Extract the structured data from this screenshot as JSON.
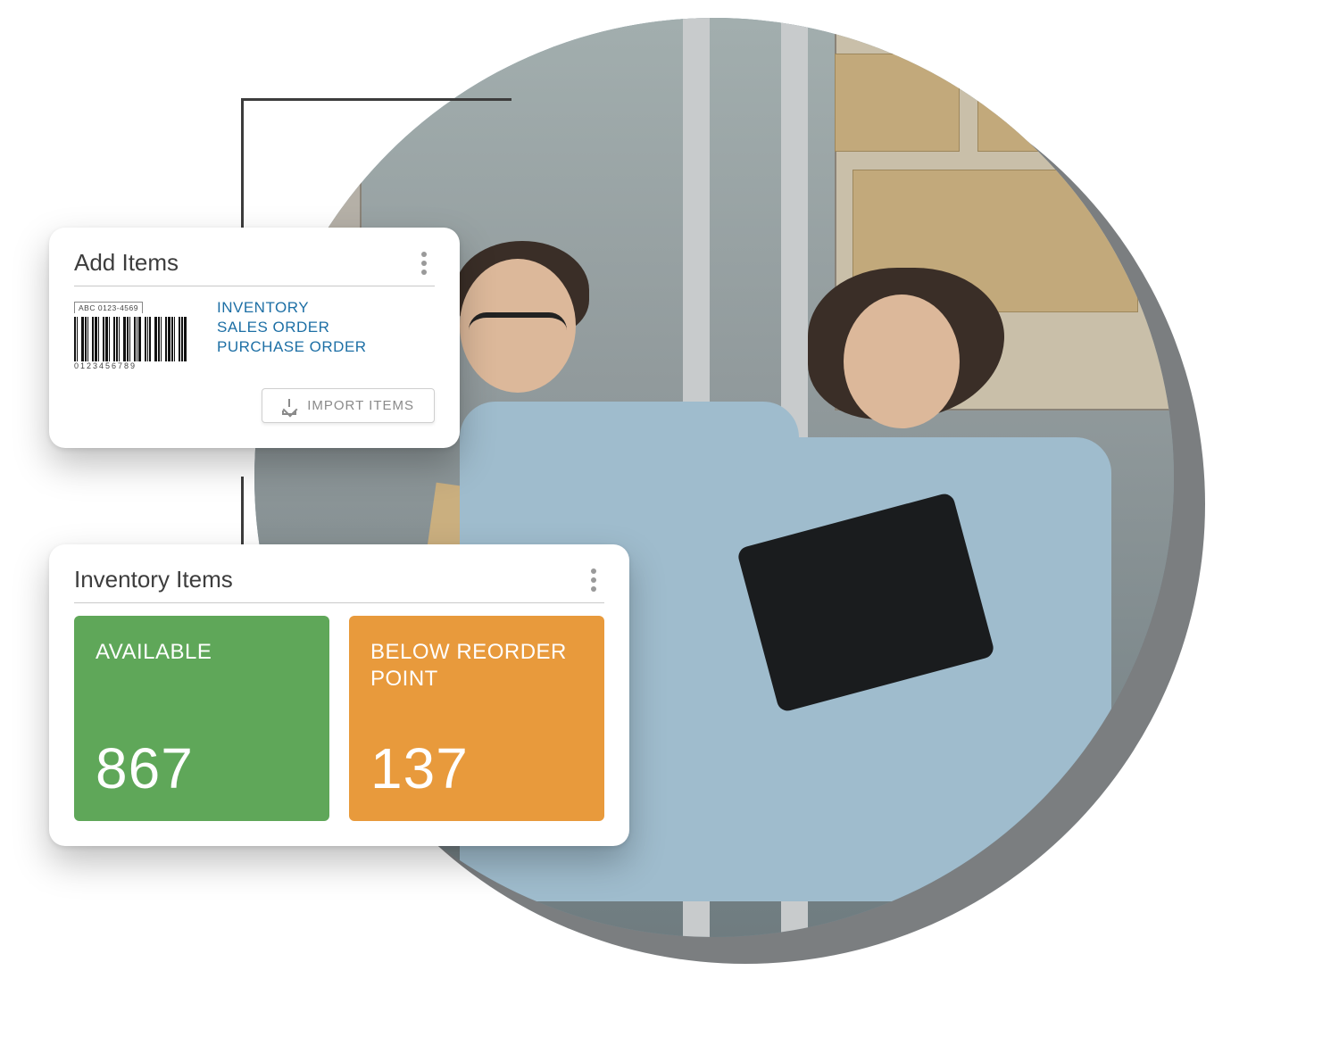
{
  "addItems": {
    "title": "Add Items",
    "barcode": {
      "topLabel": "ABC 0123-4569",
      "bottomLabel": "0123456789"
    },
    "links": [
      "INVENTORY",
      "SALES ORDER",
      "PURCHASE ORDER"
    ],
    "importButton": "IMPORT ITEMS"
  },
  "inventoryItems": {
    "title": "Inventory Items",
    "tiles": [
      {
        "label": "AVAILABLE",
        "value": "867",
        "color": "green"
      },
      {
        "label": "BELOW REORDER POINT",
        "value": "137",
        "color": "orange"
      }
    ]
  },
  "colors": {
    "green": "#5fa759",
    "orange": "#e89a3c",
    "link": "#1d6fa5"
  }
}
